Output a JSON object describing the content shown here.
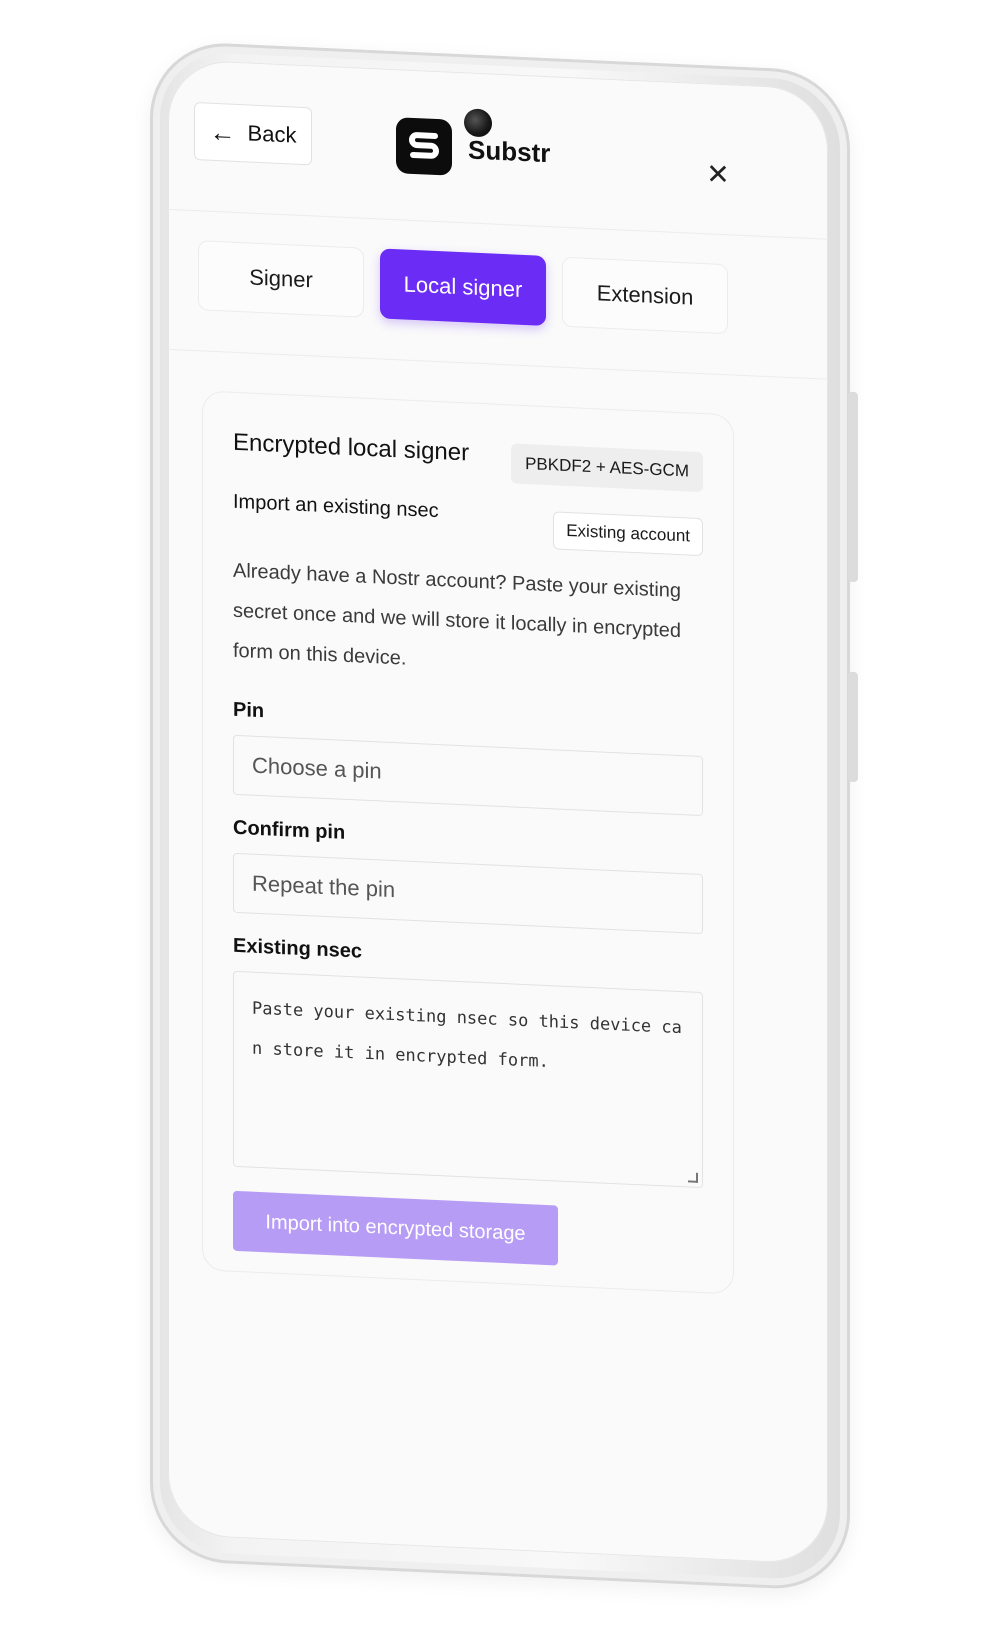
{
  "header": {
    "back_label": "Back",
    "brand_name": "Substr",
    "icons": {
      "back": "arrow-left-icon",
      "close": "close-icon",
      "logo": "substr-logo"
    }
  },
  "tabs": [
    {
      "label": "Signer",
      "active": false
    },
    {
      "label": "Local signer",
      "active": true
    },
    {
      "label": "Extension",
      "active": false
    }
  ],
  "card": {
    "title": "Encrypted local signer",
    "badge": "PBKDF2 + AES-GCM",
    "subtitle": "Import an existing nsec",
    "subtitle_badge": "Existing account",
    "description": "Already have a Nostr account? Paste your existing secret once and we will store it locally in encrypted form on this device."
  },
  "form": {
    "pin_label": "Pin",
    "pin_placeholder": "Choose a pin",
    "confirm_label": "Confirm pin",
    "confirm_placeholder": "Repeat the pin",
    "nsec_label": "Existing nsec",
    "nsec_placeholder": "Paste your existing nsec so this device can store it in encrypted form.",
    "submit_label": "Import into encrypted storage"
  },
  "colors": {
    "accent": "#6b2cf5",
    "button_disabled": "#b79cf6",
    "screen_bg": "#fafafa"
  }
}
